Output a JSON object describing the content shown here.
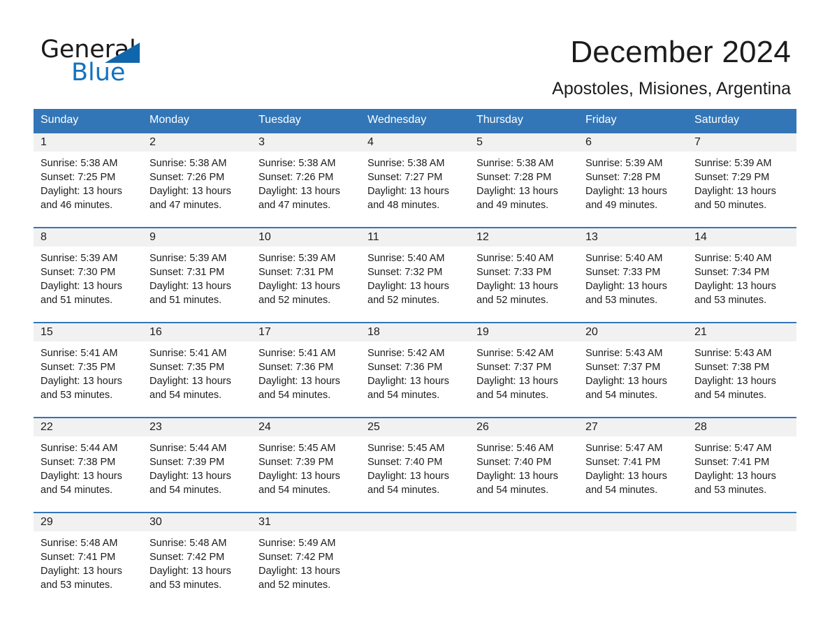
{
  "brand": {
    "name_top": "General",
    "name_bottom": "Blue",
    "accent_color": "#1273c0",
    "triangle_color": "#1066ad"
  },
  "header": {
    "month_title": "December 2024",
    "location": "Apostoles, Misiones, Argentina"
  },
  "calendar": {
    "header_bg": "#3276b8",
    "daynum_bg": "#f1f1f1",
    "weekdays": [
      "Sunday",
      "Monday",
      "Tuesday",
      "Wednesday",
      "Thursday",
      "Friday",
      "Saturday"
    ],
    "weeks": [
      {
        "days": [
          {
            "num": "1",
            "info": "Sunrise: 5:38 AM\nSunset: 7:25 PM\nDaylight: 13 hours and 46 minutes."
          },
          {
            "num": "2",
            "info": "Sunrise: 5:38 AM\nSunset: 7:26 PM\nDaylight: 13 hours and 47 minutes."
          },
          {
            "num": "3",
            "info": "Sunrise: 5:38 AM\nSunset: 7:26 PM\nDaylight: 13 hours and 47 minutes."
          },
          {
            "num": "4",
            "info": "Sunrise: 5:38 AM\nSunset: 7:27 PM\nDaylight: 13 hours and 48 minutes."
          },
          {
            "num": "5",
            "info": "Sunrise: 5:38 AM\nSunset: 7:28 PM\nDaylight: 13 hours and 49 minutes."
          },
          {
            "num": "6",
            "info": "Sunrise: 5:39 AM\nSunset: 7:28 PM\nDaylight: 13 hours and 49 minutes."
          },
          {
            "num": "7",
            "info": "Sunrise: 5:39 AM\nSunset: 7:29 PM\nDaylight: 13 hours and 50 minutes."
          }
        ]
      },
      {
        "days": [
          {
            "num": "8",
            "info": "Sunrise: 5:39 AM\nSunset: 7:30 PM\nDaylight: 13 hours and 51 minutes."
          },
          {
            "num": "9",
            "info": "Sunrise: 5:39 AM\nSunset: 7:31 PM\nDaylight: 13 hours and 51 minutes."
          },
          {
            "num": "10",
            "info": "Sunrise: 5:39 AM\nSunset: 7:31 PM\nDaylight: 13 hours and 52 minutes."
          },
          {
            "num": "11",
            "info": "Sunrise: 5:40 AM\nSunset: 7:32 PM\nDaylight: 13 hours and 52 minutes."
          },
          {
            "num": "12",
            "info": "Sunrise: 5:40 AM\nSunset: 7:33 PM\nDaylight: 13 hours and 52 minutes."
          },
          {
            "num": "13",
            "info": "Sunrise: 5:40 AM\nSunset: 7:33 PM\nDaylight: 13 hours and 53 minutes."
          },
          {
            "num": "14",
            "info": "Sunrise: 5:40 AM\nSunset: 7:34 PM\nDaylight: 13 hours and 53 minutes."
          }
        ]
      },
      {
        "days": [
          {
            "num": "15",
            "info": "Sunrise: 5:41 AM\nSunset: 7:35 PM\nDaylight: 13 hours and 53 minutes."
          },
          {
            "num": "16",
            "info": "Sunrise: 5:41 AM\nSunset: 7:35 PM\nDaylight: 13 hours and 54 minutes."
          },
          {
            "num": "17",
            "info": "Sunrise: 5:41 AM\nSunset: 7:36 PM\nDaylight: 13 hours and 54 minutes."
          },
          {
            "num": "18",
            "info": "Sunrise: 5:42 AM\nSunset: 7:36 PM\nDaylight: 13 hours and 54 minutes."
          },
          {
            "num": "19",
            "info": "Sunrise: 5:42 AM\nSunset: 7:37 PM\nDaylight: 13 hours and 54 minutes."
          },
          {
            "num": "20",
            "info": "Sunrise: 5:43 AM\nSunset: 7:37 PM\nDaylight: 13 hours and 54 minutes."
          },
          {
            "num": "21",
            "info": "Sunrise: 5:43 AM\nSunset: 7:38 PM\nDaylight: 13 hours and 54 minutes."
          }
        ]
      },
      {
        "days": [
          {
            "num": "22",
            "info": "Sunrise: 5:44 AM\nSunset: 7:38 PM\nDaylight: 13 hours and 54 minutes."
          },
          {
            "num": "23",
            "info": "Sunrise: 5:44 AM\nSunset: 7:39 PM\nDaylight: 13 hours and 54 minutes."
          },
          {
            "num": "24",
            "info": "Sunrise: 5:45 AM\nSunset: 7:39 PM\nDaylight: 13 hours and 54 minutes."
          },
          {
            "num": "25",
            "info": "Sunrise: 5:45 AM\nSunset: 7:40 PM\nDaylight: 13 hours and 54 minutes."
          },
          {
            "num": "26",
            "info": "Sunrise: 5:46 AM\nSunset: 7:40 PM\nDaylight: 13 hours and 54 minutes."
          },
          {
            "num": "27",
            "info": "Sunrise: 5:47 AM\nSunset: 7:41 PM\nDaylight: 13 hours and 54 minutes."
          },
          {
            "num": "28",
            "info": "Sunrise: 5:47 AM\nSunset: 7:41 PM\nDaylight: 13 hours and 53 minutes."
          }
        ]
      },
      {
        "days": [
          {
            "num": "29",
            "info": "Sunrise: 5:48 AM\nSunset: 7:41 PM\nDaylight: 13 hours and 53 minutes."
          },
          {
            "num": "30",
            "info": "Sunrise: 5:48 AM\nSunset: 7:42 PM\nDaylight: 13 hours and 53 minutes."
          },
          {
            "num": "31",
            "info": "Sunrise: 5:49 AM\nSunset: 7:42 PM\nDaylight: 13 hours and 52 minutes."
          },
          {
            "num": "",
            "info": ""
          },
          {
            "num": "",
            "info": ""
          },
          {
            "num": "",
            "info": ""
          },
          {
            "num": "",
            "info": ""
          }
        ]
      }
    ]
  }
}
